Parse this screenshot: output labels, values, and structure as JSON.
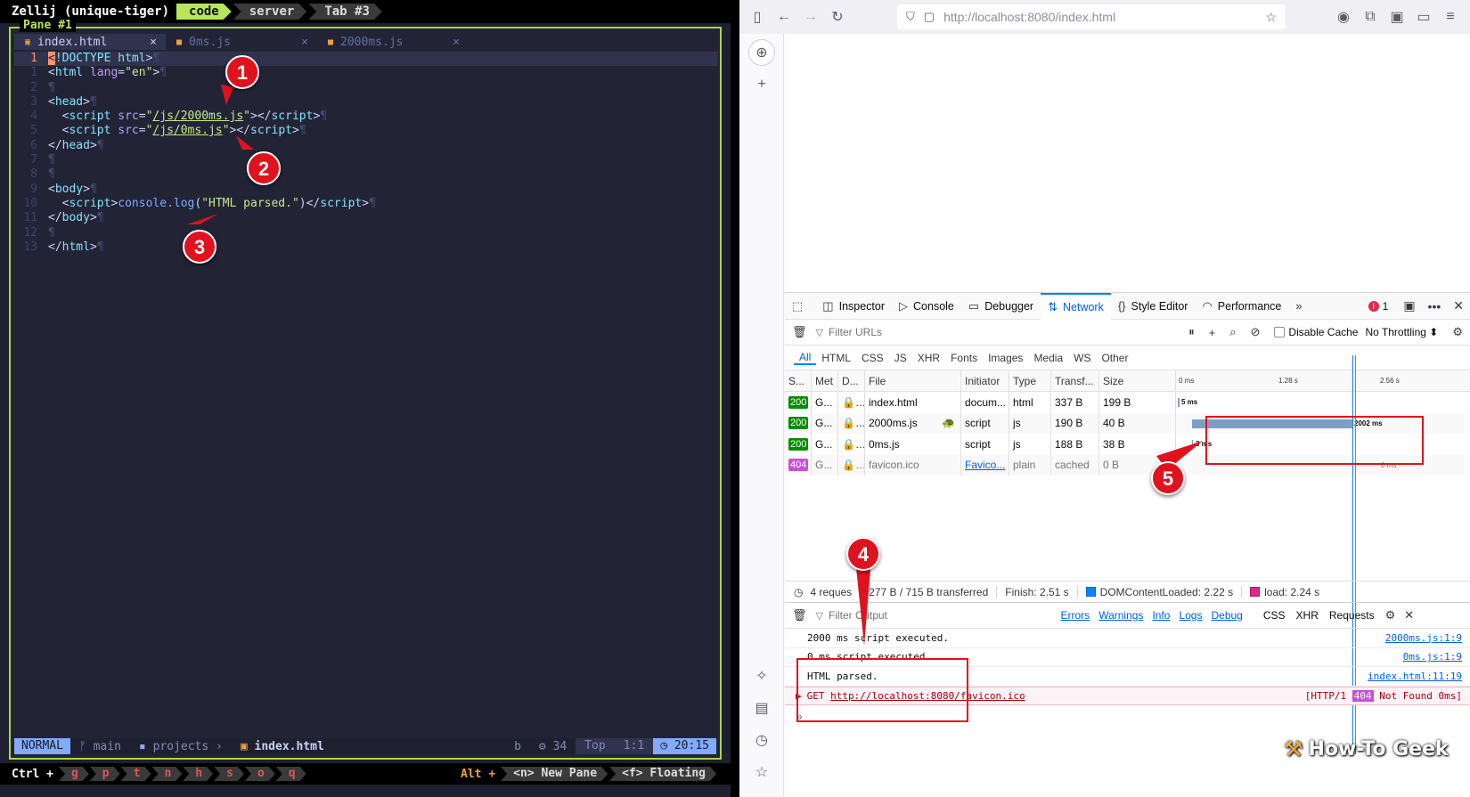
{
  "terminal": {
    "session": "Zellij (unique-tiger)",
    "tabs": [
      "code",
      "server",
      "Tab #3"
    ],
    "pane_title": "Pane #1",
    "file_tabs": [
      {
        "name": "index.html",
        "close": "×"
      },
      {
        "name": "0ms.js",
        "close": "×"
      },
      {
        "name": "2000ms.js",
        "close": "×"
      }
    ],
    "line_numbers": [
      "1",
      "1",
      "2",
      "3",
      "4",
      "5",
      "6",
      "7",
      "8",
      "9",
      "10",
      "11",
      "12",
      "13"
    ],
    "eol": "¶",
    "status": {
      "mode": "NORMAL",
      "branch": "main",
      "folder": "projects",
      "file": "index.html",
      "b": "b",
      "count": "34",
      "pos": "Top",
      "cursor": "1:1",
      "time": "20:15"
    },
    "hint": {
      "ctrl": "Ctrl +",
      "keys": [
        "g",
        "p",
        "t",
        "n",
        "h",
        "s",
        "o",
        "q"
      ],
      "alt": "Alt +",
      "new_pane": "<n> New Pane",
      "floating": "<f> Floating"
    }
  },
  "browser": {
    "url_host": "http://localhost",
    "url_rest": ":8080/index.html",
    "devtools_tabs": [
      "Inspector",
      "Console",
      "Debugger",
      "Network",
      "Style Editor",
      "Performance"
    ],
    "error_count": "1",
    "filter_urls": "Filter URLs",
    "disable_cache": "Disable Cache",
    "throttling": "No Throttling ⬍",
    "type_filters": [
      "All",
      "HTML",
      "CSS",
      "JS",
      "XHR",
      "Fonts",
      "Images",
      "Media",
      "WS",
      "Other"
    ],
    "columns": [
      "S...",
      "Met",
      "D...",
      "File",
      "Initiator",
      "Type",
      "Transf...",
      "Size"
    ],
    "waterfall_ticks": [
      "0 ms",
      "1.28 s",
      "2.56 s"
    ],
    "requests": [
      {
        "status": "200",
        "method": "G...",
        "file": "index.html",
        "initiator": "docum...",
        "type": "html",
        "transferred": "337 B",
        "size": "199 B",
        "time": "5 ms"
      },
      {
        "status": "200",
        "method": "G...",
        "file": "2000ms.js",
        "initiator": "script",
        "type": "js",
        "transferred": "190 B",
        "size": "40 B",
        "time": "2002 ms"
      },
      {
        "status": "200",
        "method": "G...",
        "file": "0ms.js",
        "initiator": "script",
        "type": "js",
        "transferred": "188 B",
        "size": "38 B",
        "time": "3 ms"
      },
      {
        "status": "404",
        "method": "G...",
        "file": "favicon.ico",
        "initiator": "Favico...",
        "type": "plain",
        "transferred": "cached",
        "size": "0 B",
        "time": "0 ms"
      }
    ],
    "summary": {
      "requests": "4 reques",
      "transferred": "277 B / 715 B transferred",
      "finish": "Finish: 2.51 s",
      "dcl": "DOMContentLoaded: 2.22 s",
      "load": "load: 2.24 s"
    },
    "console": {
      "filter": "Filter Output",
      "levels": [
        "Errors",
        "Warnings",
        "Info",
        "Logs",
        "Debug"
      ],
      "types": [
        "CSS",
        "XHR",
        "Requests"
      ],
      "rows": [
        {
          "msg": "2000 ms script executed.",
          "src": "2000ms.js:1:9"
        },
        {
          "msg": "0 ms script executed.",
          "src": "0ms.js:1:9"
        },
        {
          "msg": "HTML parsed.",
          "src": "index.html:11:19"
        }
      ],
      "error": {
        "method": "GET",
        "url": "http://localhost:8080/favicon.ico",
        "proto": "[HTTP/1",
        "code": "404",
        "text": "Not Found 0ms]"
      },
      "prompt": "»"
    }
  },
  "annotations": [
    "1",
    "2",
    "3",
    "4",
    "5"
  ],
  "logo": "How-To Geek",
  "colors": {
    "accent": "#b7e65a",
    "annotation_red": "#e0121d",
    "network_blue": "#0060df"
  }
}
